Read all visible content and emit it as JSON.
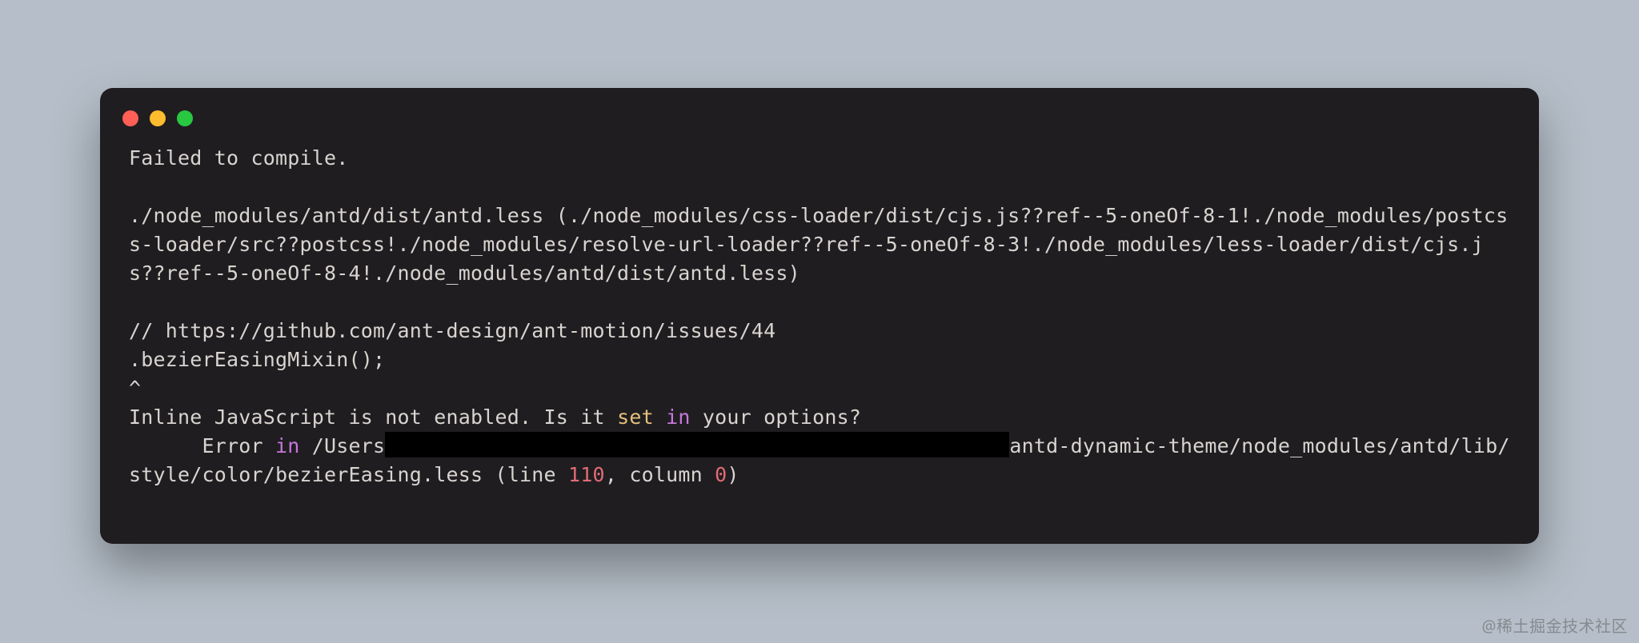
{
  "terminal": {
    "line_failed": "Failed to compile.",
    "line_blank": "",
    "line_chain": "./node_modules/antd/dist/antd.less (./node_modules/css-loader/dist/cjs.js??ref--5-oneOf-8-1!./node_modules/postcss-loader/src??postcss!./node_modules/resolve-url-loader??ref--5-oneOf-8-3!./node_modules/less-loader/dist/cjs.js??ref--5-oneOf-8-4!./node_modules/antd/dist/antd.less)",
    "line_comment": "// https://github.com/ant-design/ant-motion/issues/44",
    "line_mixin": ".bezierEasingMixin();",
    "line_caret": "^",
    "inline_msg_pre": "Inline JavaScript is not enabled. Is it ",
    "inline_msg_set": "set",
    "inline_msg_mid": " ",
    "inline_msg_in": "in",
    "inline_msg_post": " your options?",
    "err_indent": "      ",
    "err_word_error": "Error ",
    "err_word_in": "in",
    "err_path_pre": " /Users",
    "err_path_post": "antd-dynamic-theme/node_modules/antd/lib/style/color/bezierEasing.less (line ",
    "err_line_no": "110",
    "err_col_label": ", column ",
    "err_col_no": "0",
    "err_paren": ")"
  },
  "watermark": "@稀土掘金技术社区"
}
